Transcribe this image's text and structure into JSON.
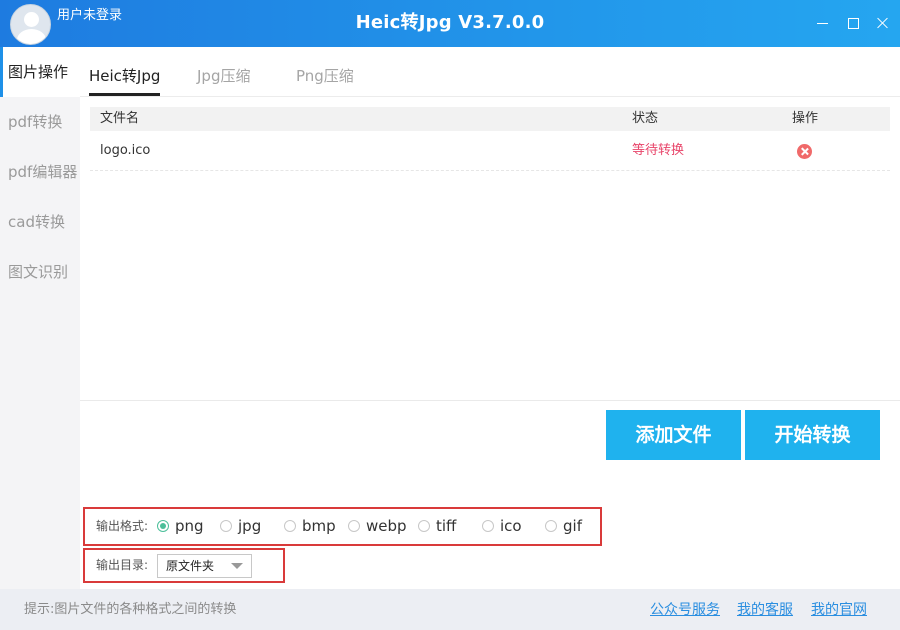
{
  "app": {
    "title": "Heic转Jpg V3.7.0.0",
    "user_label": "用户未登录"
  },
  "sidebar": {
    "items": [
      {
        "label": "图片操作",
        "active": true
      },
      {
        "label": "pdf转换",
        "active": false
      },
      {
        "label": "pdf编辑器",
        "active": false
      },
      {
        "label": "cad转换",
        "active": false
      },
      {
        "label": "图文识别",
        "active": false
      }
    ]
  },
  "tabs": [
    {
      "label": "Heic转Jpg",
      "active": true
    },
    {
      "label": "Jpg压缩",
      "active": false
    },
    {
      "label": "Png压缩",
      "active": false
    }
  ],
  "table": {
    "headers": {
      "name": "文件名",
      "status": "状态",
      "op": "操作"
    },
    "rows": [
      {
        "name": "logo.ico",
        "status": "等待转换"
      }
    ]
  },
  "buttons": {
    "add_file": "添加文件",
    "start_convert": "开始转换"
  },
  "output_format": {
    "label": "输出格式:",
    "options": [
      "png",
      "jpg",
      "bmp",
      "webp",
      "tiff",
      "ico",
      "gif"
    ],
    "selected": "png"
  },
  "output_dir": {
    "label": "输出目录:",
    "value": "原文件夹"
  },
  "statusbar": {
    "tip": "提示:图片文件的各种格式之间的转换",
    "links": [
      "公众号服务",
      "我的客服",
      "我的官网"
    ]
  },
  "colors": {
    "titlebar": "#1e7be0",
    "accent_button": "#1fb2ee",
    "status_pending": "#e8456a",
    "highlight_border": "#d93a3a",
    "link": "#2a8ee0"
  }
}
